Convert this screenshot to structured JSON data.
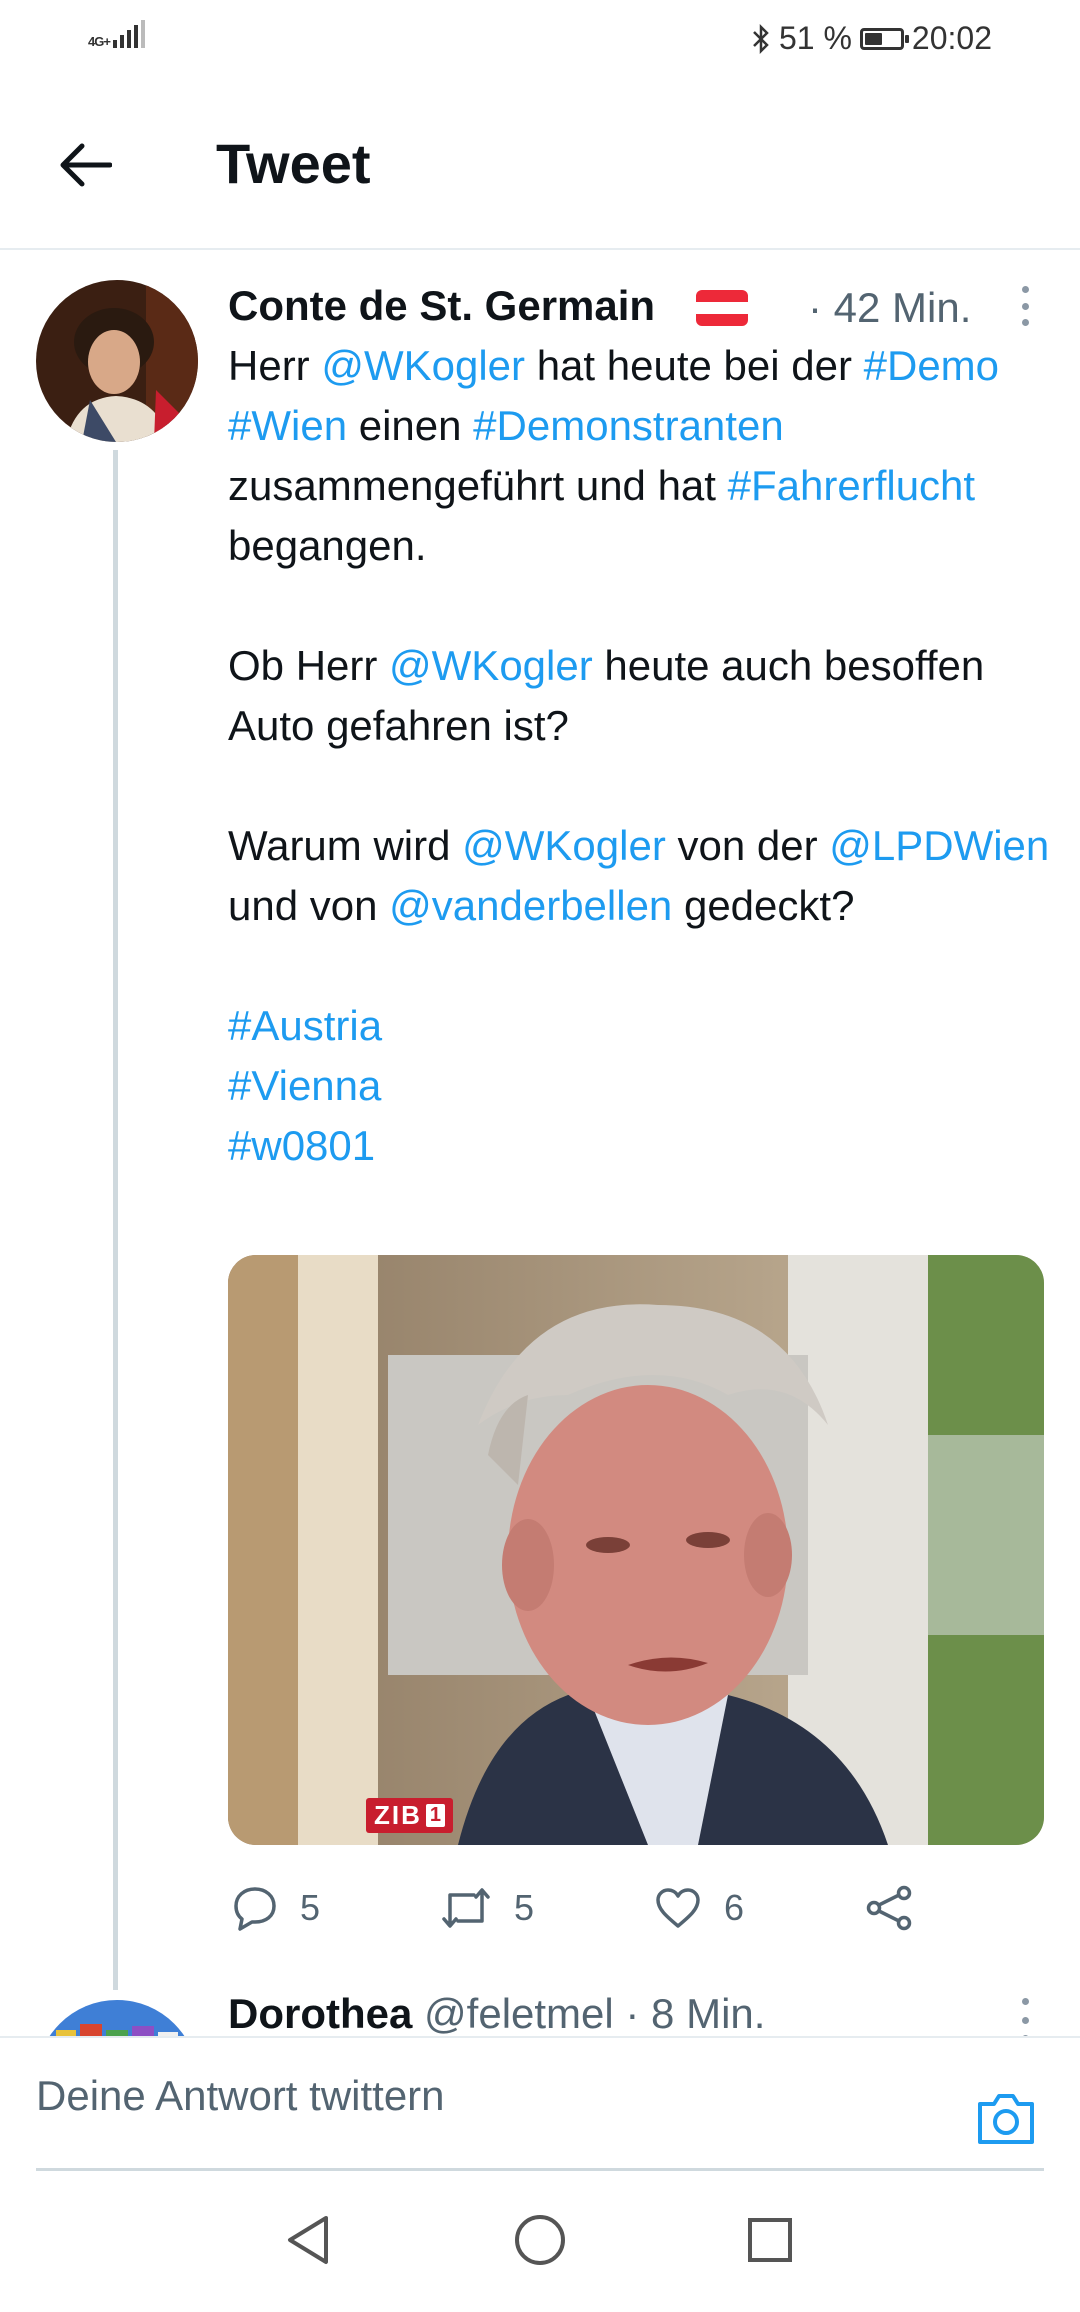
{
  "status_bar": {
    "network": "4G+",
    "signal_bars": 4,
    "battery_percent": "51 %",
    "battery_level": 0.51,
    "time": "20:02",
    "icons": [
      "bluetooth-icon",
      "battery-icon",
      "signal-icon"
    ]
  },
  "header": {
    "title": "Tweet",
    "back_icon": "arrow-left-icon"
  },
  "tweet": {
    "author_name": "Conte de St. Germain",
    "flag_colors": [
      "#ed2939",
      "#ffffff",
      "#ed2939"
    ],
    "time": "· 42 Min.",
    "paragraphs": [
      {
        "segments": [
          {
            "text": "Herr ",
            "link": false
          },
          {
            "text": "@WKogler",
            "link": true
          },
          {
            "text": " hat heute bei der ",
            "link": false
          },
          {
            "text": "#Demo",
            "link": true
          },
          {
            "text": " ",
            "link": false
          },
          {
            "text": "#Wien",
            "link": true
          },
          {
            "text": " einen ",
            "link": false
          },
          {
            "text": "#Demonstranten",
            "link": true
          },
          {
            "text": " zusammengeführt und hat ",
            "link": false
          },
          {
            "text": "#Fahrerflucht",
            "link": true
          },
          {
            "text": " begangen.",
            "link": false
          }
        ]
      },
      {
        "segments": [
          {
            "text": "Ob Herr ",
            "link": false
          },
          {
            "text": "@WKogler",
            "link": true
          },
          {
            "text": " heute auch besoffen Auto gefahren ist?",
            "link": false
          }
        ]
      },
      {
        "segments": [
          {
            "text": "Warum wird ",
            "link": false
          },
          {
            "text": "@WKogler",
            "link": true
          },
          {
            "text": " von der ",
            "link": false
          },
          {
            "text": "@LPDWien",
            "link": true
          },
          {
            "text": " und von ",
            "link": false
          },
          {
            "text": "@vanderbellen",
            "link": true
          },
          {
            "text": " gedeckt?",
            "link": false
          }
        ]
      },
      {
        "lines": [
          "#Austria",
          "#Vienna",
          "#w0801"
        ]
      }
    ],
    "media": {
      "overlay_logo": "ZIB",
      "overlay_number": "1"
    },
    "actions": [
      {
        "icon": "reply-icon",
        "count": "5"
      },
      {
        "icon": "retweet-icon",
        "count": "5"
      },
      {
        "icon": "heart-icon",
        "count": "6"
      },
      {
        "icon": "share-icon",
        "count": ""
      }
    ]
  },
  "reply_preview": {
    "name": "Dorothea",
    "meta": "@feletmel · 8 Min."
  },
  "compose": {
    "placeholder": "Deine Antwort twittern",
    "camera_icon": "camera-icon"
  },
  "navbar": {
    "icons": [
      "back-triangle-icon",
      "home-circle-icon",
      "recents-square-icon"
    ]
  },
  "colors": {
    "link": "#1d9bf0",
    "secondary_text": "#536471",
    "divider": "#e6ecf0"
  }
}
